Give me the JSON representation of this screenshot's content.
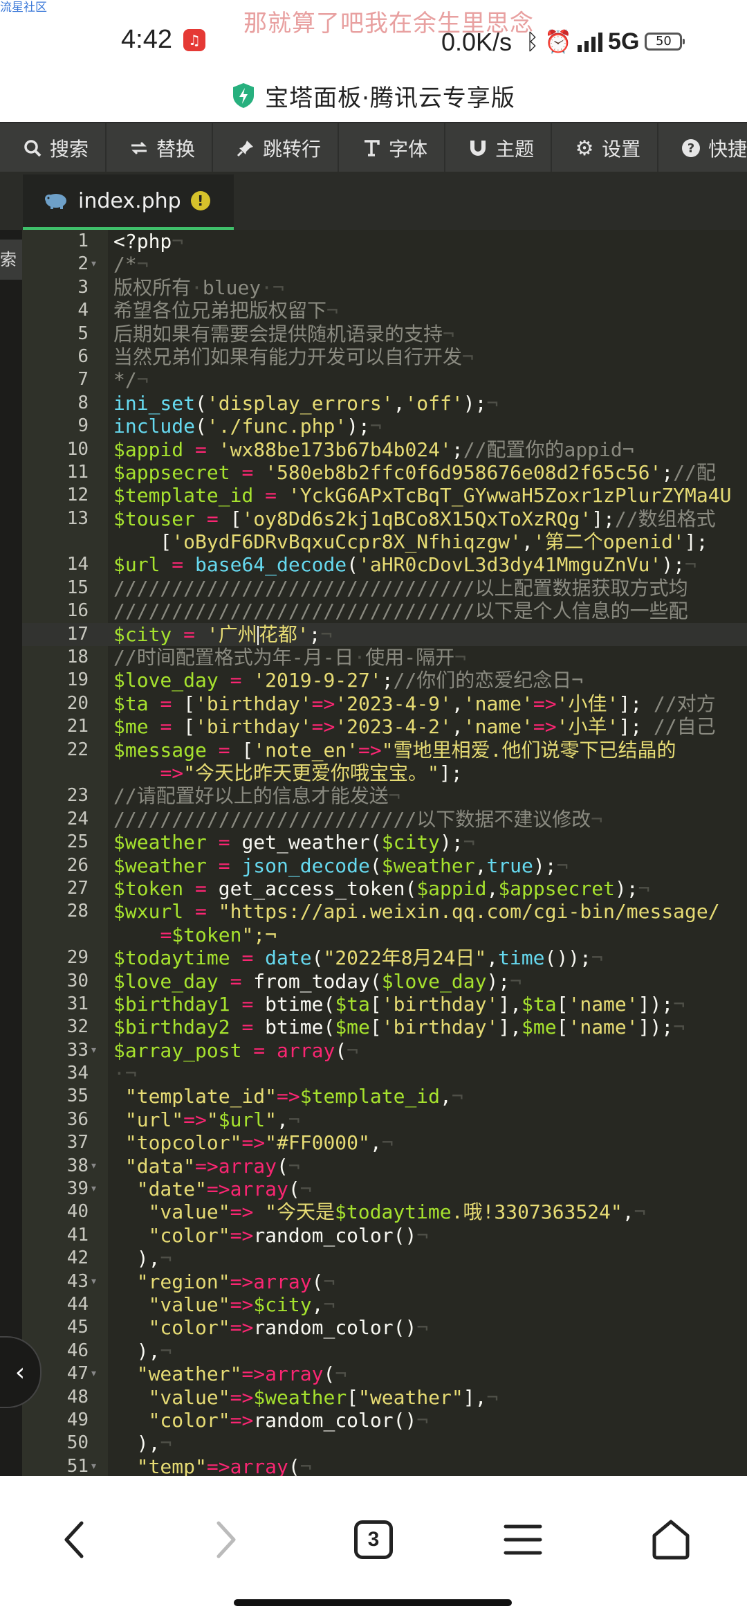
{
  "status_bar": {
    "watermark_site": "流星社区",
    "lyric": "那就算了吧我在余生里思念",
    "time": "4:42",
    "net_speed": "0.0K/s",
    "network": "5G",
    "battery": "50"
  },
  "app_title": "宝塔面板·腾讯云专享版",
  "toolbar": [
    {
      "label": "搜索",
      "icon": "search-icon"
    },
    {
      "label": "替换",
      "icon": "replace-icon"
    },
    {
      "label": "跳转行",
      "icon": "pin-icon"
    },
    {
      "label": "字体",
      "icon": "font-icon"
    },
    {
      "label": "主题",
      "icon": "magnet-icon"
    },
    {
      "label": "设置",
      "icon": "gear-icon"
    },
    {
      "label": "快捷键",
      "icon": "help-icon"
    }
  ],
  "tab": {
    "filename": "index.php",
    "status": "!"
  },
  "sidebar_tab": "索",
  "editor": {
    "lines": [
      {
        "n": "1",
        "text": "<?php¬"
      },
      {
        "n": "2",
        "text": "/*¬"
      },
      {
        "n": "3",
        "text": "版权所有·bluey·¬"
      },
      {
        "n": "4",
        "text": "希望各位兄弟把版权留下¬"
      },
      {
        "n": "5",
        "text": "后期如果有需要会提供随机语录的支持¬"
      },
      {
        "n": "6",
        "text": "当然兄弟们如果有能力开发可以自行开发¬"
      },
      {
        "n": "7",
        "text": "*/¬"
      },
      {
        "n": "8",
        "text": "ini_set('display_errors','off');¬"
      },
      {
        "n": "9",
        "text": "include('./func.php');¬"
      },
      {
        "n": "10",
        "text": "$appid = 'wx88be173b67b4b024';//配置你的appid¬"
      },
      {
        "n": "11",
        "text": "$appsecret = '580eb8b2ffc0f6d958676e08d2f65c56';//配"
      },
      {
        "n": "12",
        "text": "$template_id = 'YckG6APxTcBqT_GYwwaH5Zoxr1zPlurZYMa4U"
      },
      {
        "n": "13",
        "text": "$touser = ['oy8Dd6s2kj1qBCo8X15QxToXzRQg'];//数组格式"
      },
      {
        "n": "",
        "text": "    ['oBydF6DRvBqxuCcpr8X_Nfhiqzgw','第二个openid'];"
      },
      {
        "n": "14",
        "text": "$url = base64_decode('aHR0cDovL3d3dy41MmguZnVu');¬"
      },
      {
        "n": "15",
        "text": "///////////////////////////////以上配置数据获取方式均"
      },
      {
        "n": "16",
        "text": "///////////////////////////////以下是个人信息的一些配"
      },
      {
        "n": "17",
        "text": "$city = '广州|花都';¬"
      },
      {
        "n": "18",
        "text": "//时间配置格式为年-月-日·使用-隔开¬"
      },
      {
        "n": "19",
        "text": "$love_day = '2019-9-27';//你们的恋爱纪念日¬"
      },
      {
        "n": "20",
        "text": "$ta = ['birthday'=>'2023-4-9','name'=>'小佳']; //对方"
      },
      {
        "n": "21",
        "text": "$me = ['birthday'=>'2023-4-2','name'=>'小羊']; //自己"
      },
      {
        "n": "22",
        "text": "$message = ['note_en'=>\"雪地里相爱.他们说零下已结晶的"
      },
      {
        "n": "",
        "text": "    =>\"今天比昨天更爱你哦宝宝。\"];"
      },
      {
        "n": "23",
        "text": "//请配置好以上的信息才能发送¬"
      },
      {
        "n": "24",
        "text": "//////////////////////////以下数据不建议修改¬"
      },
      {
        "n": "25",
        "text": "$weather = get_weather($city);¬"
      },
      {
        "n": "26",
        "text": "$weather = json_decode($weather,true);¬"
      },
      {
        "n": "27",
        "text": "$token = get_access_token($appid,$appsecret);¬"
      },
      {
        "n": "28",
        "text": "$wxurl = \"https://api.weixin.qq.com/cgi-bin/message/"
      },
      {
        "n": "",
        "text": "    =$token\";¬"
      },
      {
        "n": "29",
        "text": "$todaytime = date(\"2022年8月24日\",time());¬"
      },
      {
        "n": "30",
        "text": "$love_day = from_today($love_day);¬"
      },
      {
        "n": "31",
        "text": "$birthday1 = btime($ta['birthday'],$ta['name']);¬"
      },
      {
        "n": "32",
        "text": "$birthday2 = btime($me['birthday'],$me['name']);¬"
      },
      {
        "n": "33",
        "text": "$array_post = array(¬"
      },
      {
        "n": "34",
        "text": "·¬"
      },
      {
        "n": "35",
        "text": " \"template_id\"=>$template_id,¬"
      },
      {
        "n": "36",
        "text": " \"url\"=>\"$url\",¬"
      },
      {
        "n": "37",
        "text": " \"topcolor\"=>\"#FF0000\",¬"
      },
      {
        "n": "38",
        "text": " \"data\"=>array(¬"
      },
      {
        "n": "39",
        "text": "  \"date\"=>array(¬"
      },
      {
        "n": "40",
        "text": "   \"value\"=> \"今天是$todaytime.哦!3307363524\",¬"
      },
      {
        "n": "41",
        "text": "   \"color\"=>random_color()¬"
      },
      {
        "n": "42",
        "text": "  ),¬"
      },
      {
        "n": "43",
        "text": "  \"region\"=>array(¬"
      },
      {
        "n": "44",
        "text": "   \"value\"=>$city,¬"
      },
      {
        "n": "45",
        "text": "   \"color\"=>random_color()¬"
      },
      {
        "n": "46",
        "text": "  ),¬"
      },
      {
        "n": "47",
        "text": "  \"weather\"=>array(¬"
      },
      {
        "n": "48",
        "text": "   \"value\"=>$weather[\"weather\"],¬"
      },
      {
        "n": "49",
        "text": "   \"color\"=>random_color()¬"
      },
      {
        "n": "50",
        "text": "  ),¬"
      },
      {
        "n": "51",
        "text": "  \"temp\"=>array(¬"
      }
    ]
  },
  "bottom_nav": {
    "tab_count": "3"
  }
}
